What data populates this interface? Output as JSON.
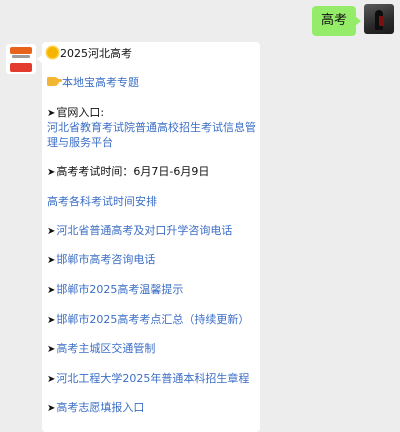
{
  "outgoing": {
    "text": "高考"
  },
  "incoming": {
    "title": "2025河北高考",
    "feature": "本地宝高考专题",
    "official_label": "官网入口:",
    "official_link_line1": "河北省教育考试院普通高校招生考试信息管",
    "official_link_line2": "理与服务平台",
    "exam_time": "高考考试时间：6月7日-6月9日",
    "schedule": "高考各科考试时间安排",
    "links": [
      "河北省普通高考及对口升学咨询电话",
      "邯郸市高考咨询电话",
      "邯郸市2025高考温馨提示",
      "邯郸市2025高考考点汇总（持续更新）",
      "高考主城区交通管制",
      "河北工程大学2025年普通本科招生章程",
      "高考志愿填报入口"
    ]
  },
  "colors": {
    "link": "#3b6ec6",
    "out_bubble": "#95ec69",
    "background": "#ededed"
  },
  "icons": {
    "arrow": "➤"
  }
}
